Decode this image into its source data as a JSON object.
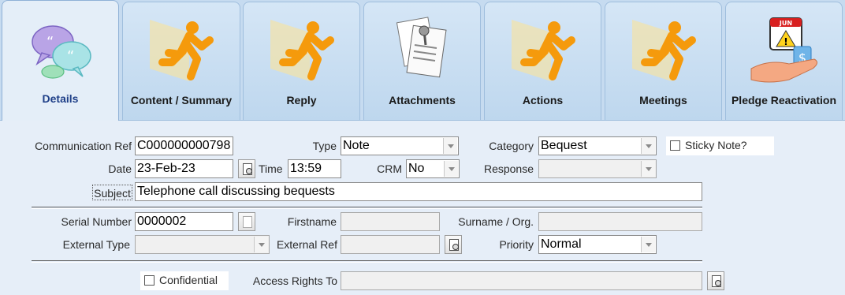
{
  "tabs": [
    {
      "label": "Details",
      "icon": "chat-bubbles-icon",
      "active": true
    },
    {
      "label": "Content / Summary",
      "icon": "running-man-icon"
    },
    {
      "label": "Reply",
      "icon": "running-man-icon"
    },
    {
      "label": "Attachments",
      "icon": "documents-paperclip-icon"
    },
    {
      "label": "Actions",
      "icon": "running-man-icon"
    },
    {
      "label": "Meetings",
      "icon": "running-man-icon"
    },
    {
      "label": "Pledge Reactivation",
      "icon": "calendar-hand-dollar-icon",
      "calendar_month": "JUN"
    }
  ],
  "form": {
    "communication_ref": {
      "label": "Communication Ref",
      "value": "C000000000798"
    },
    "type": {
      "label": "Type",
      "value": "Note"
    },
    "category": {
      "label": "Category",
      "value": "Bequest"
    },
    "sticky_note": {
      "label": "Sticky Note?",
      "checked": false
    },
    "date": {
      "label": "Date",
      "value": "23-Feb-23"
    },
    "time": {
      "label": "Time",
      "value": "13:59"
    },
    "crm": {
      "label": "CRM",
      "value": "No"
    },
    "response": {
      "label": "Response",
      "value": ""
    },
    "subject": {
      "label": "Subject",
      "value": "Telephone call discussing bequests"
    },
    "serial_number": {
      "label": "Serial Number",
      "value": "0000002"
    },
    "firstname": {
      "label": "Firstname",
      "value": ""
    },
    "surname": {
      "label": "Surname / Org.",
      "value": ""
    },
    "external_type": {
      "label": "External Type",
      "value": ""
    },
    "external_ref": {
      "label": "External Ref",
      "value": ""
    },
    "priority": {
      "label": "Priority",
      "value": "Normal"
    },
    "confidential": {
      "label": "Confidential",
      "checked": false
    },
    "access_rights": {
      "label": "Access Rights To",
      "value": ""
    }
  },
  "colors": {
    "accent": "#1e3f88",
    "running_man": "#f59a0c",
    "tab_bg": "#c6dbf0",
    "panel_bg": "#e6eef8"
  }
}
